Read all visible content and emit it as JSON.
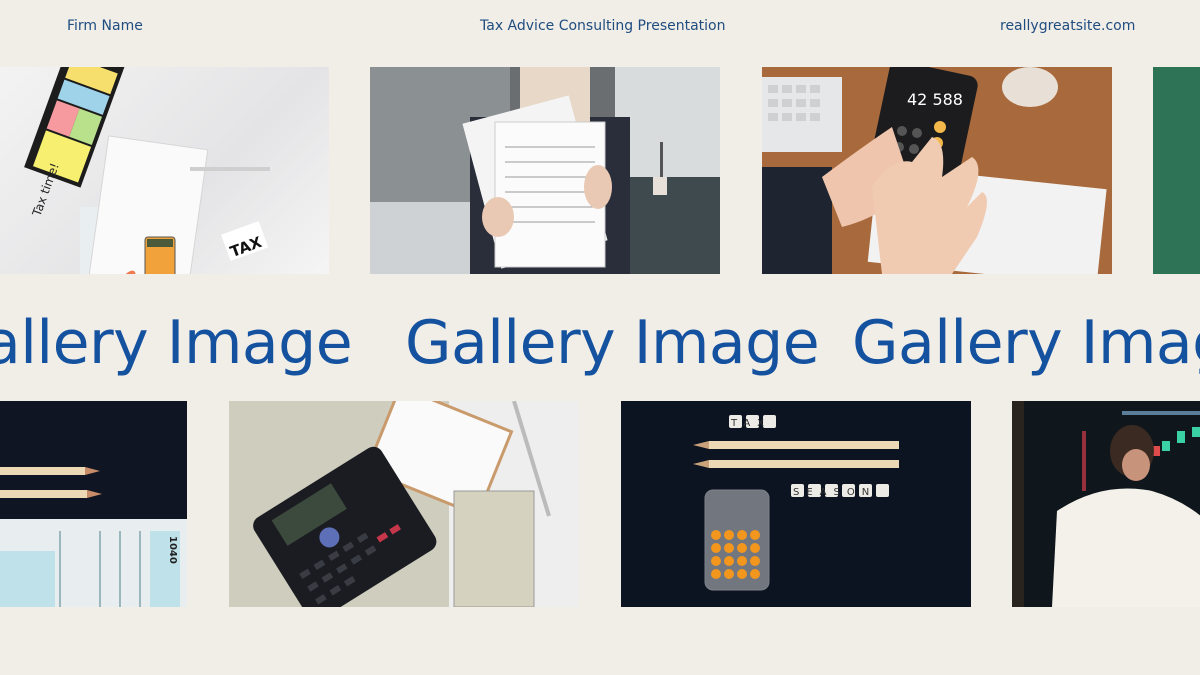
{
  "header": {
    "firm_name": "Firm Name",
    "title": "Tax Advice Consulting Presentation",
    "website": "reallygreatsite.com"
  },
  "gallery": {
    "caption_repeat": [
      "Gallery Image",
      "Gallery Image",
      "Gallery Image"
    ]
  },
  "images": {
    "top_row": [
      {
        "description": "flat lay: sticky notes 'Tax time!', calculator, TAX receipt on marble",
        "note_text": "Tax time!",
        "receipt_text": "TAX"
      },
      {
        "description": "woman holding tax forms"
      },
      {
        "description": "hands using phone calculator over tax documents",
        "display_value": "42 588"
      },
      {
        "description": "green board (partially visible)"
      }
    ],
    "bottom_row": [
      {
        "description": "pencils and 1040 tax form on dark background",
        "form_label": "1040"
      },
      {
        "description": "scientific calculator, notepad, pen and dollar bills"
      },
      {
        "description": "letter dice 'TAX' and 'SEASON', pencils and orange calculator on black",
        "dice_top": "TAX",
        "dice_bottom": "SEASON"
      },
      {
        "description": "man in white shirt touching trading chart screen"
      }
    ]
  },
  "colors": {
    "background": "#f1ede7",
    "header_text": "#1f4d80",
    "caption_text": "#1452a0"
  }
}
